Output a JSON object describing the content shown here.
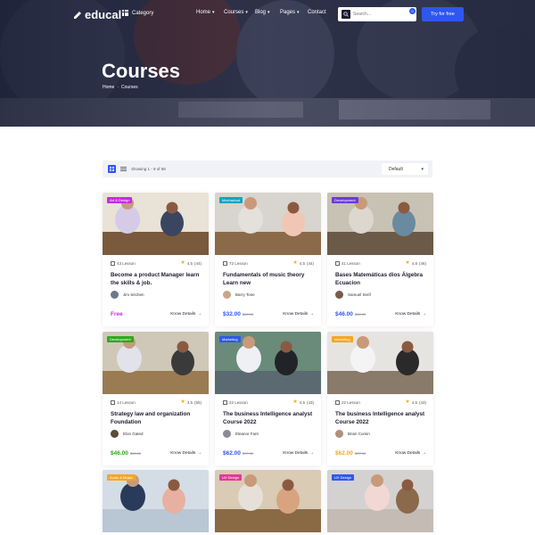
{
  "nav": {
    "logo": "educal",
    "category": "Category",
    "menu": [
      {
        "label": "Home",
        "dropdown": true
      },
      {
        "label": "Courses",
        "dropdown": true
      },
      {
        "label": "Blog",
        "dropdown": true
      },
      {
        "label": "Pages",
        "dropdown": true
      },
      {
        "label": "Contact",
        "dropdown": false
      }
    ],
    "search_placeholder": "Search...",
    "cart_count": "0",
    "cta": "Try for free"
  },
  "hero": {
    "title": "Courses",
    "breadcrumb": [
      "Home",
      "Courses"
    ]
  },
  "filter": {
    "showing": "Showing 1 - 9 of 68",
    "sort": "Default"
  },
  "courses": [
    {
      "tag": "Art & Design",
      "tag_color": "#c52be5",
      "lessons": "43 Lesson",
      "rating": "4.5",
      "reviews": "(44)",
      "title": "Become a product Manager learn the skills & job.",
      "author": "Jim Séchen",
      "price": "Free",
      "old_price": "",
      "price_color": "#c52be5",
      "details": "Know Details"
    },
    {
      "tag": "Mechanical",
      "tag_color": "#0aa6c4",
      "lessons": "72 Lesson",
      "rating": "4.5",
      "reviews": "(44)",
      "title": "Fundamentals of music theory Learn new",
      "author": "Barry Tone",
      "price": "$32.00",
      "old_price": "$68.00",
      "price_color": "#2f57ef",
      "details": "Know Details"
    },
    {
      "tag": "Development",
      "tag_color": "#6b3ad9",
      "lessons": "41 Lesson",
      "rating": "4.8",
      "reviews": "(46)",
      "title": "Bases Matemáticas dios Álgebra Ecuacion",
      "author": "Samuel Serif",
      "price": "$46.00",
      "old_price": "$68.00",
      "price_color": "#2f57ef",
      "details": "Know Details"
    },
    {
      "tag": "Development",
      "tag_color": "#30a820",
      "lessons": "14 Lesson",
      "rating": "3.5",
      "reviews": "(55)",
      "title": "Strategy law and organization Foundation",
      "author": "Elon Gated",
      "price": "$46.00",
      "old_price": "$68.00",
      "price_color": "#30a820",
      "details": "Know Details"
    },
    {
      "tag": "Marketing",
      "tag_color": "#2f57ef",
      "lessons": "22 Lesson",
      "rating": "4.5",
      "reviews": "(43)",
      "title": "The business Intelligence analyst Course 2022",
      "author": "Eleanor Fant",
      "price": "$62.00",
      "old_price": "$97.00",
      "price_color": "#2f57ef",
      "details": "Know Details"
    },
    {
      "tag": "Marketing",
      "tag_color": "#f5a623",
      "lessons": "22 Lesson",
      "rating": "4.5",
      "reviews": "(43)",
      "title": "The business Intelligence analyst Course 2022",
      "author": "Brian Cumin",
      "price": "$62.00",
      "old_price": "$97.00",
      "price_color": "#f5a623",
      "details": "Know Details"
    },
    {
      "tag": "Audio & Music",
      "tag_color": "#f5a623",
      "lessons": "",
      "rating": "",
      "reviews": "",
      "title": "",
      "author": "",
      "price": "",
      "old_price": "",
      "price_color": "#2f57ef",
      "details": ""
    },
    {
      "tag": "UX Design",
      "tag_color": "#e5389a",
      "lessons": "",
      "rating": "",
      "reviews": "",
      "title": "",
      "author": "",
      "price": "",
      "old_price": "",
      "price_color": "#2f57ef",
      "details": ""
    },
    {
      "tag": "UX Design",
      "tag_color": "#2f57ef",
      "lessons": "",
      "rating": "",
      "reviews": "",
      "title": "",
      "author": "",
      "price": "",
      "old_price": "",
      "price_color": "#2f57ef",
      "details": ""
    }
  ]
}
